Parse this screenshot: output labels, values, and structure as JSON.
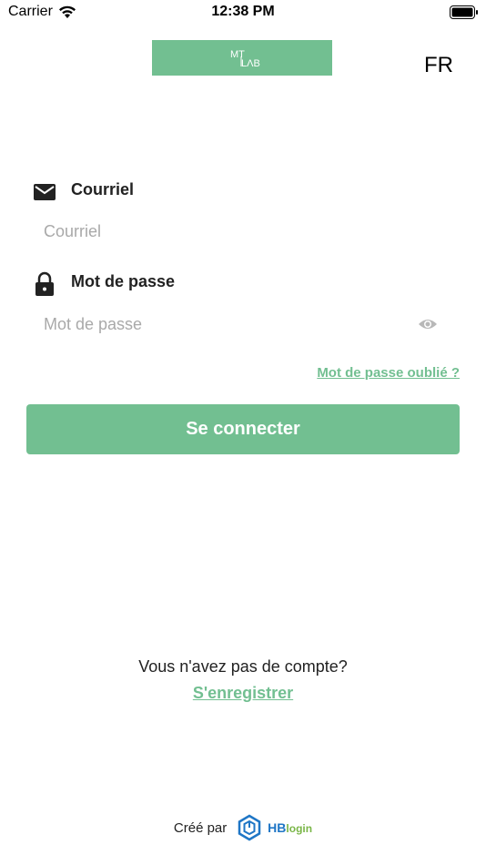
{
  "status_bar": {
    "carrier": "Carrier",
    "time": "12:38 PM",
    "wifi_icon": "wifi-icon",
    "battery_icon": "battery-icon"
  },
  "header": {
    "logo_text_top": "MT",
    "logo_text_bottom": "LΛB",
    "language": "FR"
  },
  "form": {
    "email": {
      "icon": "envelope-icon",
      "label": "Courriel",
      "placeholder": "Courriel",
      "value": ""
    },
    "password": {
      "icon": "lock-icon",
      "label": "Mot de passe",
      "placeholder": "Mot de passe",
      "value": "",
      "toggle_icon": "eye-icon"
    },
    "forgot_password": "Mot de passe oublié ?",
    "submit_label": "Se connecter"
  },
  "register": {
    "prompt": "Vous n'avez pas de compte?",
    "link": "S'enregistrer"
  },
  "footer": {
    "created_by": "Créé par",
    "brand_hb": "HB",
    "brand_login": "login"
  },
  "colors": {
    "accent": "#72bf91",
    "brand_blue": "#1f76c6",
    "brand_green": "#7ab648"
  }
}
